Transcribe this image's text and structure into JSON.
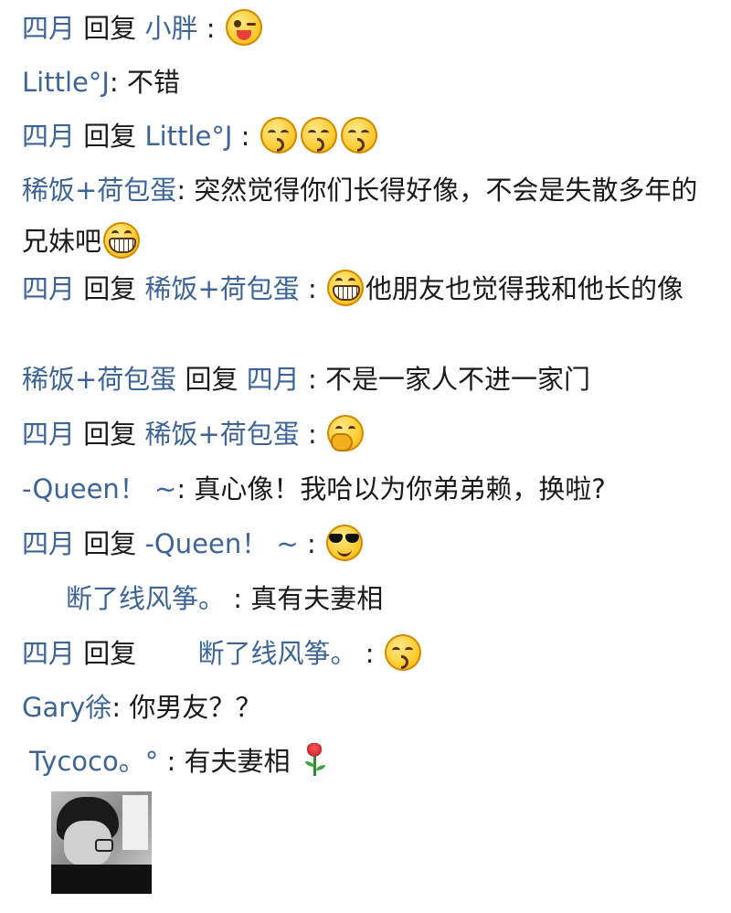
{
  "comments": [
    {
      "name": "四月",
      "verb": "回复",
      "target": "小胖",
      "sep": " :",
      "emoji": [
        "tongue-wink-emoji"
      ]
    },
    {
      "name": "Little°J",
      "sep": ":",
      "text": " 不错"
    },
    {
      "name": "四月",
      "verb": "回复",
      "target": "Little°J",
      "sep": " :",
      "emoji": [
        "kiss-emoji",
        "kiss-emoji",
        "kiss-emoji"
      ]
    },
    {
      "name": "稀饭+荷包蛋",
      "sep": ":",
      "text": " 突然觉得你们长得好像，不会是失散多年的兄妹吧",
      "emoji": [
        "grin-emoji"
      ]
    },
    {
      "name": "四月",
      "verb": "回复",
      "target": "稀饭+荷包蛋",
      "sep": " :",
      "emoji": [
        "grin-emoji"
      ],
      "text": "他朋友也觉得我和他长的像"
    },
    {
      "name": "稀饭+荷包蛋",
      "verb": "回复",
      "target": "四月",
      "sep": " :",
      "text": " 不是一家人不进一家门"
    },
    {
      "name": "四月",
      "verb": "回复",
      "target": "稀饭+荷包蛋",
      "sep": " :",
      "emoji": [
        "shy-emoji"
      ]
    },
    {
      "name": "-Queen！ ~",
      "sep": ":",
      "text": " 真心像！我哈以为你弟弟赖，换啦?"
    },
    {
      "name": "四月",
      "verb": "回复",
      "target": "-Queen！ ~",
      "sep": " :",
      "emoji": [
        "cool-emoji"
      ]
    },
    {
      "name": "断了线风筝。",
      "sep": " :",
      "text": " 真有夫妻相"
    },
    {
      "name": "四月",
      "verb": "回复",
      "target": "断了线风筝。",
      "sep": " :",
      "emoji": [
        "kiss-emoji"
      ]
    },
    {
      "name": "Gary徐",
      "sep": ":",
      "text": " 你男友？？"
    },
    {
      "name": "Tycoco。°",
      "sep": " :",
      "text": " 有夫妻相",
      "emoji": [
        "rose-emoji"
      ]
    }
  ],
  "attachment": {
    "icon": "photo-thumbnail"
  },
  "colors": {
    "name": "#3e6497",
    "text": "#1a1a1a",
    "background": "#ffffff"
  }
}
